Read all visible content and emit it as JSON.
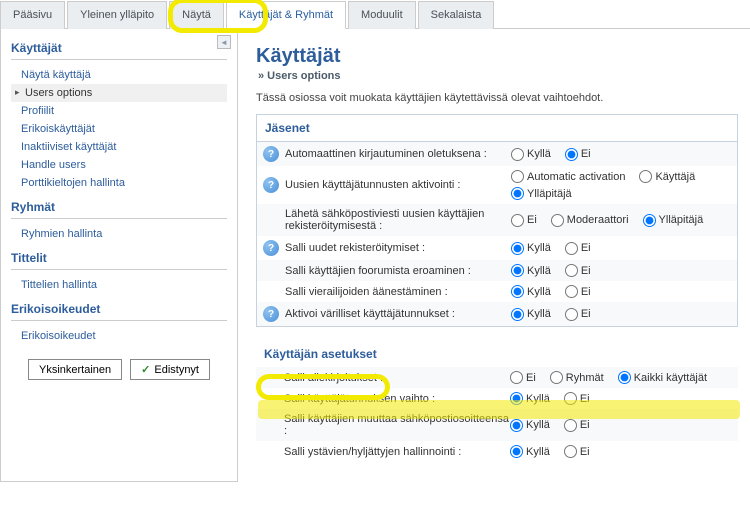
{
  "tabs": [
    "Pääsivu",
    "Yleinen ylläpito",
    "Näytä",
    "Käyttäjät & Ryhmät",
    "Moduulit",
    "Sekalaista"
  ],
  "tab_active": 3,
  "sidebar": {
    "sections": [
      {
        "title": "Käyttäjät",
        "items": [
          "Näytä käyttäjä",
          "Users options",
          "Profiilit",
          "Erikoiskäyttäjät",
          "Inaktiiviset käyttäjät",
          "Handle users",
          "Porttikieltojen hallinta"
        ],
        "current": 1
      },
      {
        "title": "Ryhmät",
        "items": [
          "Ryhmien hallinta"
        ]
      },
      {
        "title": "Tittelit",
        "items": [
          "Tittelien hallinta"
        ]
      },
      {
        "title": "Erikoisoikeudet",
        "items": [
          "Erikoisoikeudet"
        ]
      }
    ],
    "simple": "Yksinkertainen",
    "advanced": "Edistynyt"
  },
  "page": {
    "title": "Käyttäjät",
    "breadcrumb": "» Users options",
    "desc": "Tässä osiossa voit muokata käyttäjien käytettävissä olevat vaihtoehdot."
  },
  "opt": {
    "kylla": "Kyllä",
    "ei": "Ei",
    "auto": "Automatic activation",
    "kayttaja": "Käyttäjä",
    "yllapitaja": "Ylläpitäjä",
    "moderaattori": "Moderaattori",
    "ryhmat": "Ryhmät",
    "kaikki": "Kaikki käyttäjät"
  },
  "panel1": {
    "title": "Jäsenet",
    "rows": [
      {
        "label": "Automaattinen kirjautuminen oletuksena :",
        "help": true,
        "opts": [
          "kylla",
          "ei"
        ],
        "sel": 1
      },
      {
        "label": "Uusien käyttäjätunnusten aktivointi :",
        "help": true,
        "opts": [
          "auto",
          "kayttaja",
          "yllapitaja"
        ],
        "sel": 2
      },
      {
        "label": "Lähetä sähköpostiviesti uusien käyttäjien rekisteröitymisestä :",
        "opts": [
          "ei",
          "moderaattori",
          "yllapitaja"
        ],
        "sel": 2
      },
      {
        "label": "Salli uudet rekisteröitymiset :",
        "help": true,
        "opts": [
          "kylla",
          "ei"
        ],
        "sel": 0
      },
      {
        "label": "Salli käyttäjien foorumista eroaminen :",
        "opts": [
          "kylla",
          "ei"
        ],
        "sel": 0
      },
      {
        "label": "Salli vierailijoiden äänestäminen :",
        "opts": [
          "kylla",
          "ei"
        ],
        "sel": 0
      },
      {
        "label": "Aktivoi värilliset käyttäjätunnukset :",
        "help": true,
        "opts": [
          "kylla",
          "ei"
        ],
        "sel": 0
      }
    ]
  },
  "panel2": {
    "title": "Käyttäjän asetukset",
    "rows": [
      {
        "label": "Salli allekirjoitukset :",
        "opts": [
          "ei",
          "ryhmat",
          "kaikki"
        ],
        "sel": 2
      },
      {
        "label": "Salli käyttäjätunnuksen vaihto :",
        "opts": [
          "kylla",
          "ei"
        ],
        "sel": 0
      },
      {
        "label": "Salli käyttäjien muuttaa sähköpostiosoitteensa :",
        "opts": [
          "kylla",
          "ei"
        ],
        "sel": 0
      },
      {
        "label": "Salli ystävien/hyljättyjen hallinnointi :",
        "opts": [
          "kylla",
          "ei"
        ],
        "sel": 0
      }
    ]
  }
}
